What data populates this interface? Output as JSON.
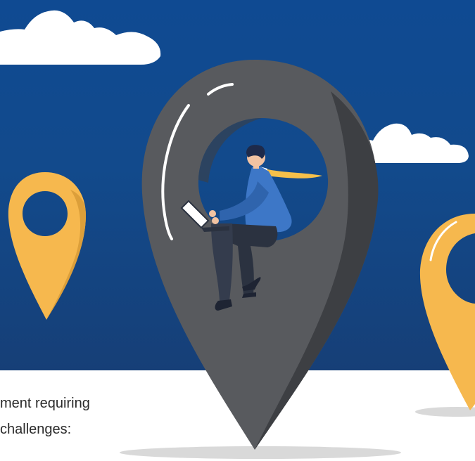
{
  "caption": {
    "line1": "ment requiring",
    "line2": "challenges:"
  },
  "illustration": {
    "subject": "businessman sitting in map pin with laptop",
    "icons": [
      "cloud-icon",
      "map-pin-icon",
      "laptop-icon"
    ]
  },
  "colors": {
    "sky_top": "#0f4a92",
    "sky_bottom": "#163f77",
    "pin_gray": "#585a5e",
    "pin_yellow": "#f6b84e",
    "cloud": "#ffffff",
    "suit_blue": "#3d77c7",
    "tie_yellow": "#f6c04a"
  }
}
